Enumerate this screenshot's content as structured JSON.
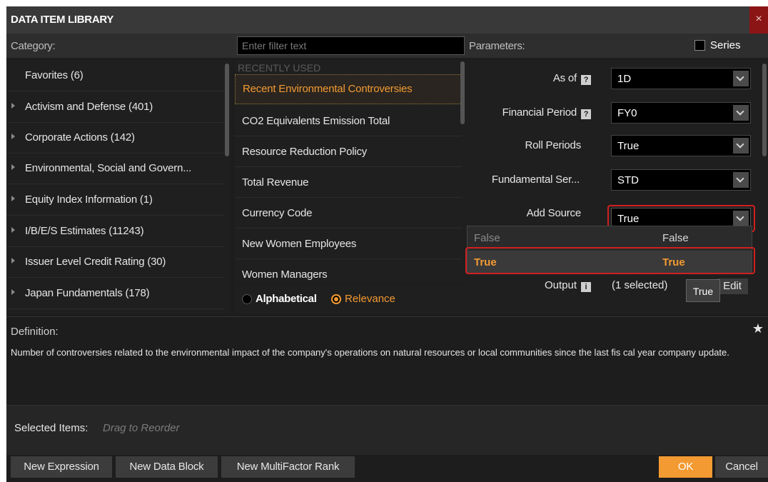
{
  "window": {
    "title": "DATA ITEM LIBRARY",
    "close_glyph": "×"
  },
  "headers": {
    "category": "Category:",
    "filter_placeholder": "Enter filter text",
    "parameters": "Parameters:",
    "series": "Series"
  },
  "categories": [
    {
      "label": "Favorites (6)",
      "has_arrow": false
    },
    {
      "label": "Activism and Defense (401)",
      "has_arrow": true
    },
    {
      "label": "Corporate Actions (142)",
      "has_arrow": true
    },
    {
      "label": "Environmental, Social and Govern...",
      "has_arrow": true
    },
    {
      "label": "Equity Index Information (1)",
      "has_arrow": true
    },
    {
      "label": "I/B/E/S Estimates (11243)",
      "has_arrow": true
    },
    {
      "label": "Issuer Level Credit Rating (30)",
      "has_arrow": true
    },
    {
      "label": "Japan Fundamentals (178)",
      "has_arrow": true
    }
  ],
  "items": {
    "section_header": "RECENTLY USED",
    "list": [
      "Recent Environmental Controversies",
      "CO2 Equivalents Emission Total",
      "Resource Reduction Policy",
      "Total Revenue",
      "Currency Code",
      "New Women Employees",
      "Women Managers"
    ],
    "selected_index": 0
  },
  "sort": {
    "alphabetical": "Alphabetical",
    "relevance": "Relevance",
    "selected": "relevance"
  },
  "parameters": {
    "as_of": {
      "label": "As of",
      "value": "1D",
      "help_icon": "?"
    },
    "financial_period": {
      "label": "Financial Period",
      "value": "FY0",
      "help_icon": "?"
    },
    "roll_periods": {
      "label": "Roll Periods",
      "value": "True"
    },
    "fundamental_series": {
      "label": "Fundamental Ser...",
      "value": "STD"
    },
    "add_source": {
      "label": "Add Source",
      "value": "True"
    },
    "output": {
      "label": "Output",
      "info_icon": "i",
      "value": "(1 selected)",
      "edit_label": "Edit"
    }
  },
  "dropdown": {
    "options": [
      {
        "left": "False",
        "right": "False"
      },
      {
        "left": "True",
        "right": "True"
      }
    ],
    "highlighted": "True",
    "tooltip": "True"
  },
  "definition": {
    "title": "Definition:",
    "text": "Number of controversies related to the environmental impact of the company's operations on natural resources or local communities since the last fis cal year company update.",
    "star_icon": "★"
  },
  "selected_items": {
    "title": "Selected Items:",
    "hint": "Drag to Reorder"
  },
  "footer": {
    "new_expression": "New Expression",
    "new_data_block": "New Data Block",
    "new_multifactor_rank": "New MultiFactor Rank",
    "ok": "OK",
    "cancel": "Cancel"
  },
  "colors": {
    "accent": "#f39a32",
    "highlight_border": "#d21f1f",
    "close_bg": "#8b1515"
  }
}
